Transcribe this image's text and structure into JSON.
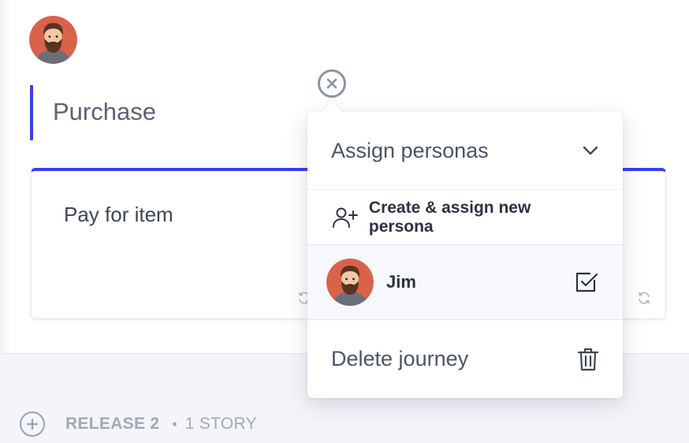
{
  "journey": {
    "title": "Purchase",
    "avatar": "bearded-man-avatar"
  },
  "story_card": {
    "title": "Pay for item"
  },
  "popup": {
    "assign_label": "Assign personas",
    "create_label": "Create & assign new persona",
    "personas": [
      {
        "name": "Jim",
        "checked": true,
        "avatar": "bearded-man-avatar"
      }
    ],
    "delete_label": "Delete journey"
  },
  "release": {
    "name": "RELEASE 2",
    "separator": "•",
    "count": "1 STORY"
  },
  "colors": {
    "accent": "#3a3ef0",
    "avatar_bg": "#d9624a",
    "muted_text": "#a3a8b6"
  }
}
